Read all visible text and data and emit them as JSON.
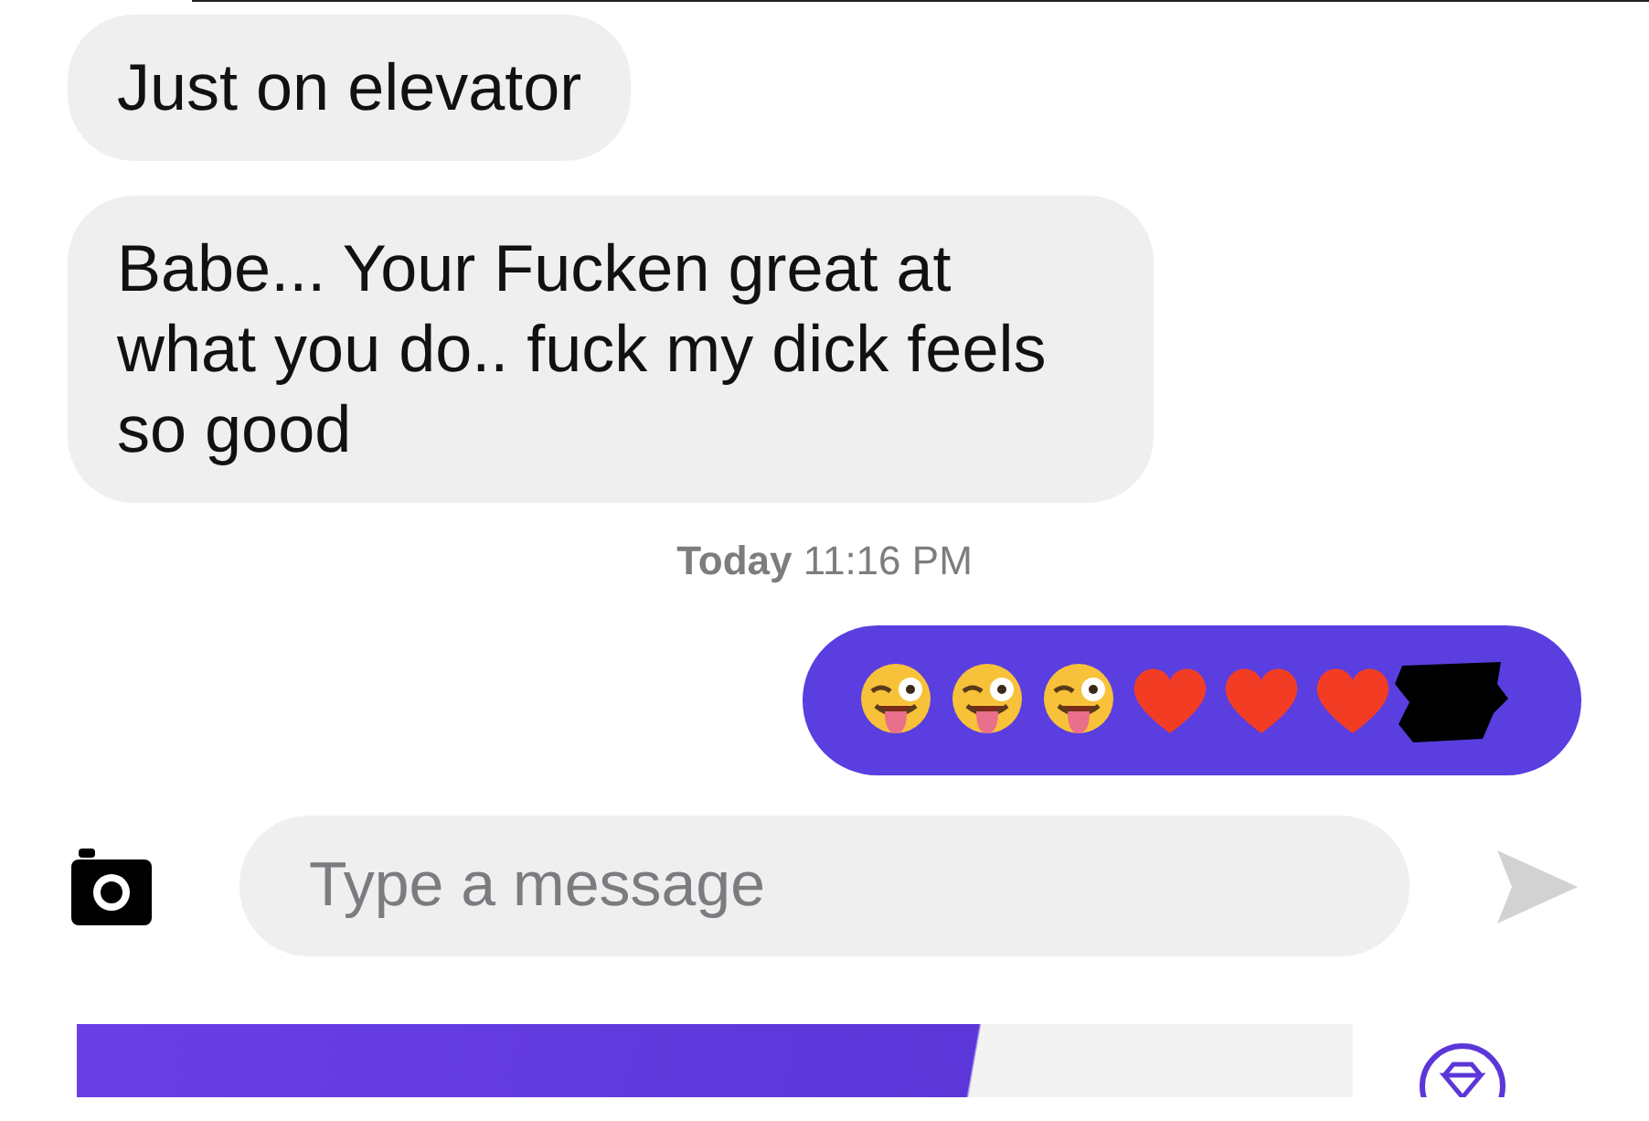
{
  "messages": [
    {
      "kind": "received",
      "text": "Just on elevator"
    },
    {
      "kind": "received",
      "text": "Babe... Your Fucken great at what you do.. fuck my dick feels so good"
    }
  ],
  "timestamp": {
    "day": "Today",
    "time": "11:16 PM"
  },
  "sent_message": {
    "emojis": [
      {
        "kind": "tongue-wink"
      },
      {
        "kind": "tongue-wink"
      },
      {
        "kind": "tongue-wink"
      },
      {
        "kind": "heart"
      },
      {
        "kind": "heart"
      },
      {
        "kind": "heart"
      }
    ],
    "redacted": true
  },
  "composer": {
    "placeholder": "Type a message"
  }
}
